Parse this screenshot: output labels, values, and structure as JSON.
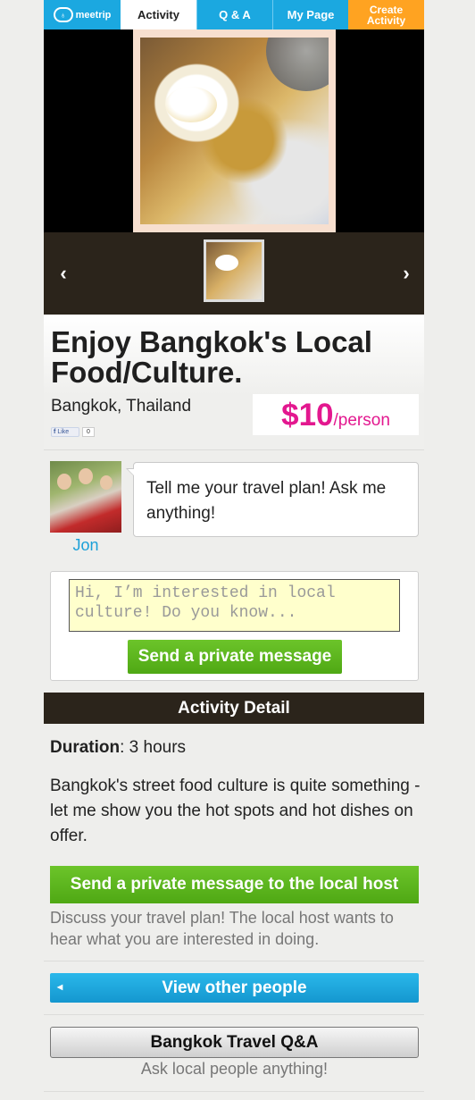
{
  "nav": {
    "logo_text": "meetrip",
    "tabs": [
      {
        "label": "Activity",
        "active": true
      },
      {
        "label": "Q & A",
        "active": false
      },
      {
        "label": "My Page",
        "active": false
      }
    ],
    "create_line1": "Create",
    "create_line2": "Activity"
  },
  "gallery": {
    "prev_icon": "‹",
    "next_icon": "›"
  },
  "activity": {
    "title": "Enjoy Bangkok's Local Food/Culture.",
    "location": "Bangkok, Thailand",
    "price": "$10",
    "price_unit": "/person",
    "fb_like_label": "Like",
    "fb_like_count": "0"
  },
  "host": {
    "name": "Jon",
    "bubble_text": "Tell me your travel plan! Ask me anything!"
  },
  "message": {
    "placeholder": "Hi, I’m interested in local culture! Do you know...",
    "send_label": "Send a private message"
  },
  "detail": {
    "header": "Activity Detail",
    "duration_label": "Duration",
    "duration_value": ": 3 hours",
    "description": "Bangkok's street food culture is quite something - let me show you the hot spots and hot dishes on offer.",
    "host_message_label": "Send a private message to the local host",
    "host_message_note": "Discuss your travel plan! The local host wants to hear what you are interested in doing."
  },
  "other": {
    "view_other_label": "View other people",
    "qa_label": "Bangkok Travel Q&A",
    "qa_note": "Ask local people anything!"
  },
  "colors": {
    "nav_blue": "#1ba8e0",
    "create_orange": "#ffa321",
    "price_pink": "#e3188f",
    "green_button": "#5bb51c",
    "dark_header": "#2b241b"
  }
}
